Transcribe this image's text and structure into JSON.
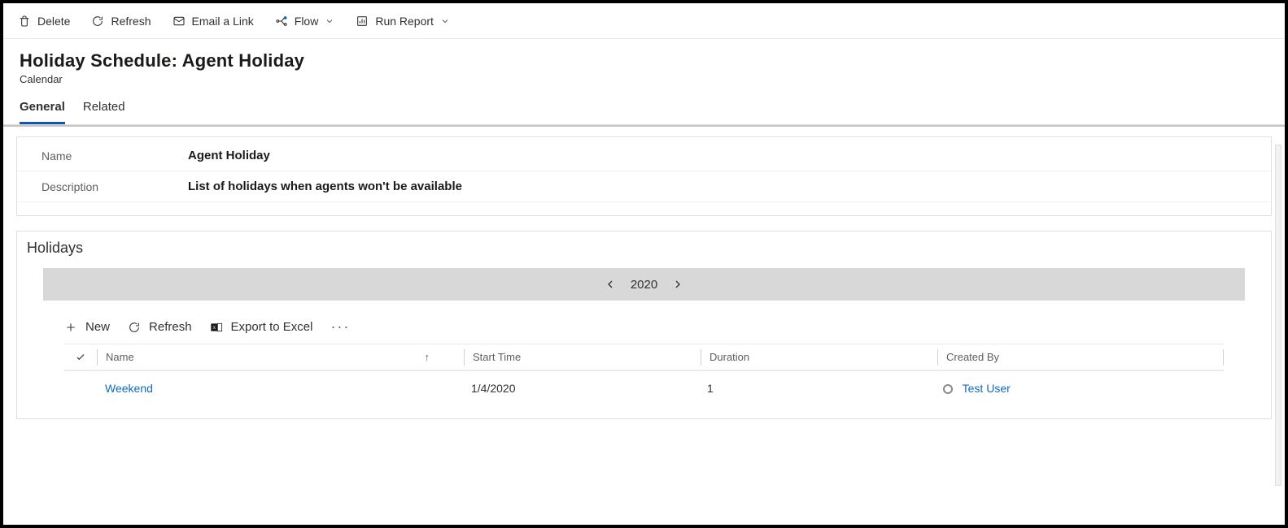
{
  "commandBar": {
    "delete": "Delete",
    "refresh": "Refresh",
    "emailLink": "Email a Link",
    "flow": "Flow",
    "runReport": "Run Report"
  },
  "header": {
    "title": "Holiday Schedule: Agent Holiday",
    "subtitle": "Calendar"
  },
  "tabs": {
    "general": "General",
    "related": "Related"
  },
  "form": {
    "nameLabel": "Name",
    "nameValue": "Agent Holiday",
    "descLabel": "Description",
    "descValue": "List of holidays when agents won't be available"
  },
  "holidays": {
    "sectionTitle": "Holidays",
    "year": "2020",
    "subBar": {
      "new": "New",
      "refresh": "Refresh",
      "export": "Export to Excel"
    },
    "columns": {
      "name": "Name",
      "start": "Start Time",
      "duration": "Duration",
      "createdBy": "Created By"
    },
    "rows": [
      {
        "name": "Weekend",
        "start": "1/4/2020",
        "duration": "1",
        "createdBy": "Test User"
      }
    ]
  }
}
